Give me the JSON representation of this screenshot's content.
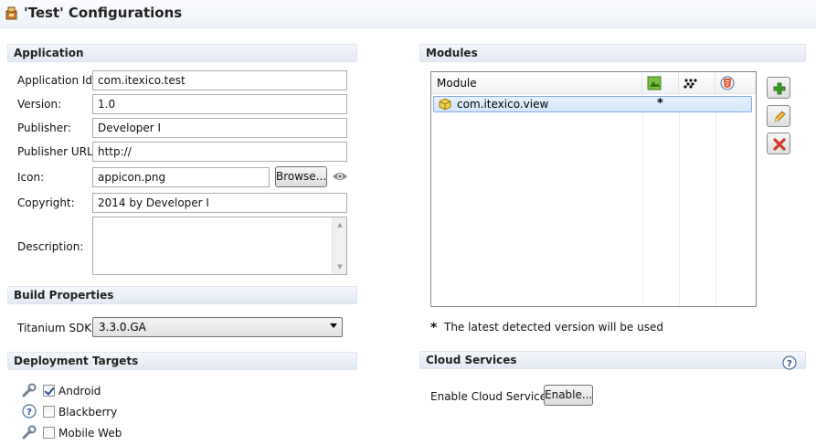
{
  "header": {
    "title": "'Test' Configurations"
  },
  "application": {
    "section_title": "Application",
    "app_id_label": "Application Id:",
    "app_id_value": "com.itexico.test",
    "version_label": "Version:",
    "version_value": "1.0",
    "publisher_label": "Publisher:",
    "publisher_value": "Developer I",
    "publisher_url_label": "Publisher URL:",
    "publisher_url_value": "http://",
    "icon_label": "Icon:",
    "icon_value": "appicon.png",
    "browse_label": "Browse...",
    "copyright_label": "Copyright:",
    "copyright_value": "2014 by Developer I",
    "description_label": "Description:",
    "description_value": ""
  },
  "build": {
    "section_title": "Build Properties",
    "sdk_label": "Titanium SDK:",
    "sdk_value": "3.3.0.GA"
  },
  "deployment": {
    "section_title": "Deployment Targets",
    "targets": [
      {
        "label": "Android",
        "checked": true,
        "icon": "wrench-icon"
      },
      {
        "label": "Blackberry",
        "checked": false,
        "icon": "help-icon"
      },
      {
        "label": "Mobile Web",
        "checked": false,
        "icon": "wrench-icon"
      }
    ]
  },
  "modules": {
    "section_title": "Modules",
    "column_module": "Module",
    "column_icons": [
      "android-icon",
      "blackberry-icon",
      "html5-icon"
    ],
    "rows": [
      {
        "name": "com.itexico.view",
        "android": "*",
        "blackberry": "",
        "mobileweb": ""
      }
    ],
    "footnote_marker": "*",
    "footnote": "The latest detected version will be used"
  },
  "cloud": {
    "section_title": "Cloud Services",
    "enable_label": "Enable Cloud Services:",
    "enable_button": "Enable..."
  },
  "colors": {
    "selection_border": "#84acdd",
    "add_green": "#3a9a2a",
    "remove_red": "#d33a2a"
  }
}
